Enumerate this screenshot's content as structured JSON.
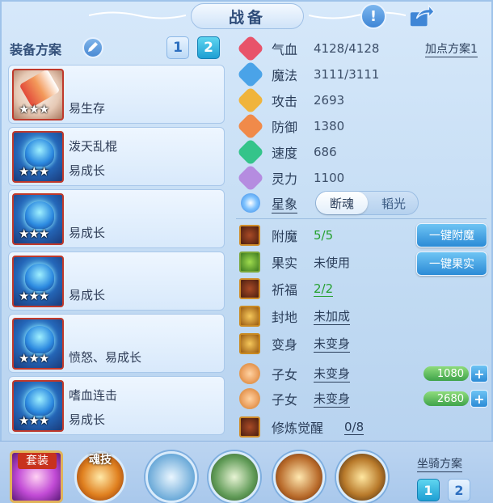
{
  "header": {
    "title": "战备"
  },
  "equipment": {
    "scheme_label": "装备方案",
    "tabs": [
      "1",
      "2"
    ],
    "items": [
      {
        "name": "",
        "trait": "易生存",
        "stars": "★★★"
      },
      {
        "name": "泼天乱棍",
        "trait": "易成长",
        "stars": "★★★"
      },
      {
        "name": "",
        "trait": "易成长",
        "stars": "★★★"
      },
      {
        "name": "",
        "trait": "易成长",
        "stars": "★★★"
      },
      {
        "name": "",
        "trait": "愤怒、易成长",
        "stars": "★★★"
      },
      {
        "name": "嗜血连击",
        "trait": "易成长",
        "stars": "★★★"
      }
    ]
  },
  "stats": {
    "plan_link": "加点方案1",
    "rows": [
      {
        "label": "气血",
        "value": "4128/4128",
        "icon": "heart-icon",
        "color": "#e8536a"
      },
      {
        "label": "魔法",
        "value": "3111/3111",
        "icon": "mana-icon",
        "color": "#4aa3e8"
      },
      {
        "label": "攻击",
        "value": "2693",
        "icon": "sword-icon",
        "color": "#f0b43c"
      },
      {
        "label": "防御",
        "value": "1380",
        "icon": "shield-icon",
        "color": "#f08a4a"
      },
      {
        "label": "速度",
        "value": "686",
        "icon": "lightning-icon",
        "color": "#34c48a"
      },
      {
        "label": "灵力",
        "value": "1100",
        "icon": "spirit-icon",
        "color": "#b58ce0"
      }
    ]
  },
  "star_sign": {
    "label": "星象",
    "options": [
      "断魂",
      "韬光"
    ],
    "selected": "断魂"
  },
  "buffs": {
    "rows": [
      {
        "label": "附魔",
        "value": "5/5",
        "icon": "enchant-icon"
      },
      {
        "label": "果实",
        "value": "未使用",
        "icon": "fruit-icon"
      },
      {
        "label": "祈福",
        "value": "2/2",
        "icon": "blessing-icon"
      },
      {
        "label": "封地",
        "value": "未加成",
        "icon": "fief-icon"
      },
      {
        "label": "变身",
        "value": "未变身",
        "icon": "transform-icon"
      },
      {
        "label": "子女",
        "value": "未变身",
        "icon": "child-icon"
      },
      {
        "label": "子女",
        "value": "未变身",
        "icon": "child-icon"
      },
      {
        "label": "修炼觉醒",
        "value": "0/8",
        "icon": "cultivation-icon"
      }
    ],
    "one_click_enchant": "一键附魔",
    "one_click_fruit": "一键果实",
    "child_values": [
      "1080",
      "2680"
    ]
  },
  "bottom": {
    "suit_label": "套装",
    "soul_skill_label": "魂技",
    "mount_label": "坐骑方案",
    "mount_tabs": [
      "1",
      "2"
    ]
  }
}
